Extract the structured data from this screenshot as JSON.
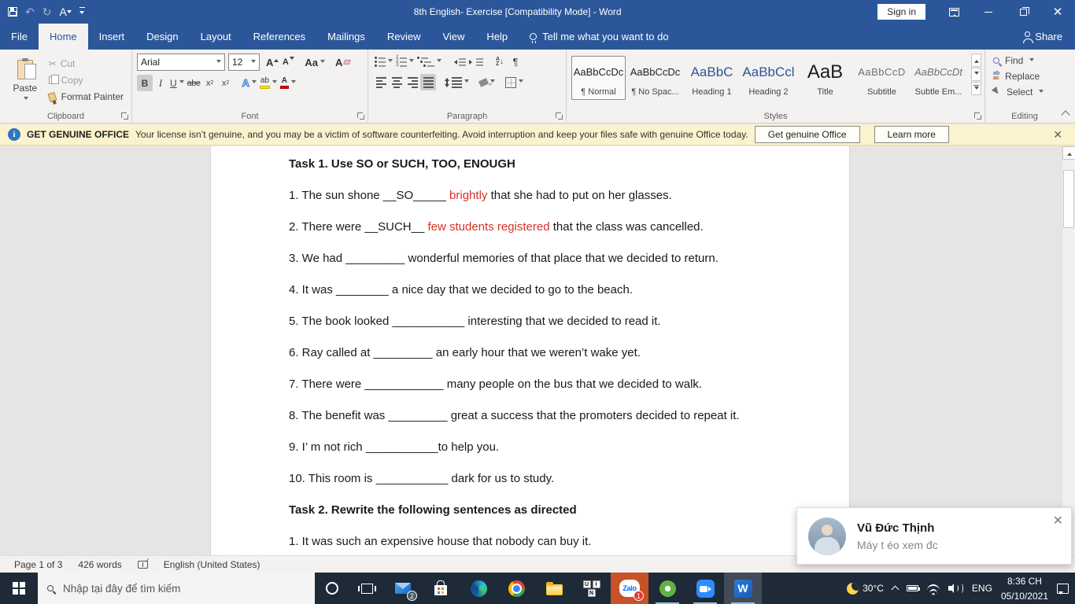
{
  "window": {
    "title": "8th English- Exercise [Compatibility Mode]  -  Word",
    "sign_in_label": "Sign in"
  },
  "quick_access": {
    "icons": [
      "save",
      "undo",
      "redo",
      "font-command",
      "customize-toolbar"
    ]
  },
  "ribbon": {
    "tabs": [
      {
        "label": "File",
        "kind": "file"
      },
      {
        "label": "Home",
        "active": true
      },
      {
        "label": "Insert"
      },
      {
        "label": "Design"
      },
      {
        "label": "Layout"
      },
      {
        "label": "References"
      },
      {
        "label": "Mailings"
      },
      {
        "label": "Review"
      },
      {
        "label": "View"
      },
      {
        "label": "Help"
      }
    ],
    "tell_me": "Tell me what you want to do",
    "share_label": "Share",
    "clipboard": {
      "label": "Clipboard",
      "paste": "Paste",
      "cut": "Cut",
      "copy": "Copy",
      "format_painter": "Format Painter"
    },
    "font": {
      "label": "Font",
      "family": "Arial",
      "size": "12"
    },
    "paragraph": {
      "label": "Paragraph"
    },
    "styles": {
      "label": "Styles",
      "items": [
        {
          "sample": "AaBbCcDc",
          "name": "¶ Normal",
          "kind": "normal",
          "selected": true
        },
        {
          "sample": "AaBbCcDc",
          "name": "¶ No Spac...",
          "kind": "normal"
        },
        {
          "sample": "AaBbC",
          "name": "Heading 1",
          "kind": "heading"
        },
        {
          "sample": "AaBbCcl",
          "name": "Heading 2",
          "kind": "heading"
        },
        {
          "sample": "AaB",
          "name": "Title",
          "kind": "title"
        },
        {
          "sample": "AaBbCcD",
          "name": "Subtitle",
          "kind": "subtitle"
        },
        {
          "sample": "AaBbCcDt",
          "name": "Subtle Em...",
          "kind": "subtle"
        }
      ]
    },
    "editing": {
      "label": "Editing",
      "find": "Find",
      "replace": "Replace",
      "select": "Select"
    }
  },
  "message_bar": {
    "title": "GET GENUINE OFFICE",
    "text": "Your license isn’t genuine, and you may be a victim of software counterfeiting. Avoid interruption and keep your files safe with genuine Office today.",
    "primary_button": "Get genuine Office",
    "secondary_button": "Learn more"
  },
  "document": {
    "blocks": [
      {
        "type": "heading",
        "text": "Task 1. Use SO or SUCH, TOO, ENOUGH"
      },
      {
        "type": "line",
        "segments": [
          {
            "text": "1. The sun shone __SO_____ "
          },
          {
            "text": "brightly",
            "color": "red"
          },
          {
            "text": " that she had to put on her glasses."
          }
        ]
      },
      {
        "type": "line",
        "segments": [
          {
            "text": "2. There were __SUCH__ "
          },
          {
            "text": "few students registered",
            "color": "red"
          },
          {
            "text": " that the class was cancelled."
          }
        ]
      },
      {
        "type": "line",
        "segments": [
          {
            "text": "3. We had _________ wonderful memories of that place that we decided to return."
          }
        ]
      },
      {
        "type": "line",
        "segments": [
          {
            "text": "4. It was ________ a nice day that we decided to go to the beach."
          }
        ]
      },
      {
        "type": "line",
        "segments": [
          {
            "text": "5. The book looked ___________ interesting that we decided to read it."
          }
        ]
      },
      {
        "type": "line",
        "segments": [
          {
            "text": "6. Ray called at _________ an early hour that we weren’t wake yet."
          }
        ]
      },
      {
        "type": "line",
        "segments": [
          {
            "text": "7. There were ____________ many people on the bus that we decided to walk."
          }
        ]
      },
      {
        "type": "line",
        "segments": [
          {
            "text": "8. The benefit was _________ great a success that the promoters decided to repeat it."
          }
        ]
      },
      {
        "type": "line",
        "segments": [
          {
            "text": "9. I’ m not rich ___________to help you."
          }
        ]
      },
      {
        "type": "line",
        "segments": [
          {
            "text": "10. This room is ___________ dark for us to study."
          }
        ]
      },
      {
        "type": "heading",
        "text": "Task 2. Rewrite the following sentences as directed"
      },
      {
        "type": "line",
        "segments": [
          {
            "text": "1. It was such an expensive house that nobody can buy it."
          }
        ]
      }
    ]
  },
  "status_bar": {
    "page": "Page 1 of 3",
    "words": "426 words",
    "language": "English (United States)"
  },
  "notification": {
    "name": "Vũ Đức Thịnh",
    "message": "Máy t éo xem đc"
  },
  "taskbar": {
    "search_placeholder": "Nhập tại đây để tìm kiếm",
    "apps": [
      {
        "name": "mail",
        "badge": "2",
        "badge_style": "gray"
      },
      {
        "name": "store"
      },
      {
        "name": "edge"
      },
      {
        "name": "chrome"
      },
      {
        "name": "explorer"
      },
      {
        "name": "unikey",
        "keys": [
          "U",
          "I",
          "N"
        ]
      },
      {
        "name": "zalo",
        "logo_text": "Zalo",
        "badge": "1",
        "highlight": true,
        "running": true
      },
      {
        "name": "coccoc",
        "running": true
      },
      {
        "name": "zoom",
        "running": true
      },
      {
        "name": "word",
        "logo_text": "W",
        "active": true,
        "running": true
      }
    ],
    "tray": {
      "temperature": "30°C",
      "language": "ENG",
      "time": "8:36 CH",
      "date": "05/10/2021"
    }
  },
  "colors": {
    "accent": "#2b579a",
    "red_text": "#d93025",
    "message_bar_bg": "#fbf3ce",
    "taskbar_bg": "#1e2a38",
    "zalo_flash": "#c75227"
  }
}
